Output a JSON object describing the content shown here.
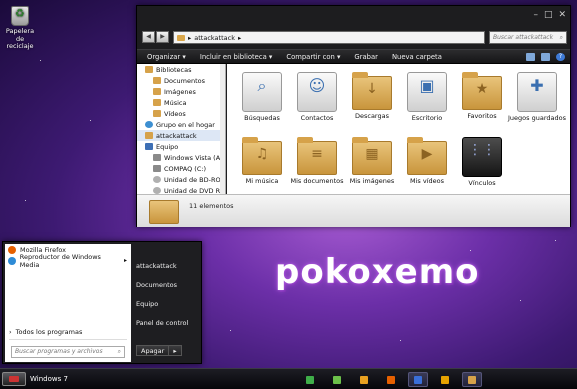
{
  "desktop": {
    "recycle_bin_label": "Papelera de reciclaje"
  },
  "explorer": {
    "address": "attackattack",
    "search_placeholder": "Buscar attackattack",
    "toolbar": {
      "organize": "Organizar ▾",
      "include": "Incluir en biblioteca ▾",
      "share": "Compartir con ▾",
      "burn": "Grabar",
      "new_folder": "Nueva carpeta"
    },
    "nav_items": [
      {
        "label": "Bibliotecas",
        "icon": "library-icon",
        "indent": 0
      },
      {
        "label": "Documentos",
        "icon": "folder-icon",
        "indent": 1
      },
      {
        "label": "Imágenes",
        "icon": "folder-icon",
        "indent": 1
      },
      {
        "label": "Música",
        "icon": "folder-icon",
        "indent": 1
      },
      {
        "label": "Vídeos",
        "icon": "folder-icon",
        "indent": 1
      },
      {
        "label": "Grupo en el hogar",
        "icon": "homegroup-icon",
        "indent": 0
      },
      {
        "label": "attackattack",
        "icon": "user-folder-icon",
        "indent": 0,
        "selected": true
      },
      {
        "label": "Equipo",
        "icon": "computer-icon",
        "indent": 0
      },
      {
        "label": "Windows Vista (A:)",
        "icon": "drive-icon",
        "indent": 1
      },
      {
        "label": "COMPAQ (C:)",
        "icon": "drive-icon",
        "indent": 1
      },
      {
        "label": "Unidad de BD-ROM (",
        "icon": "disc-icon",
        "indent": 1
      },
      {
        "label": "Unidad de DVD RW (",
        "icon": "disc-icon",
        "indent": 1
      }
    ],
    "tiles": [
      {
        "label": "Búsquedas",
        "icon": "search-folder-icon"
      },
      {
        "label": "Contactos",
        "icon": "contacts-icon"
      },
      {
        "label": "Descargas",
        "icon": "downloads-folder-icon"
      },
      {
        "label": "Escritorio",
        "icon": "desktop-folder-icon"
      },
      {
        "label": "Favoritos",
        "icon": "favorites-folder-icon"
      },
      {
        "label": "Juegos guardados",
        "icon": "saved-games-icon"
      },
      {
        "label": "Mi música",
        "icon": "music-folder-icon"
      },
      {
        "label": "Mis documentos",
        "icon": "documents-folder-icon"
      },
      {
        "label": "Mis imágenes",
        "icon": "pictures-folder-icon"
      },
      {
        "label": "Mis vídeos",
        "icon": "videos-folder-icon"
      },
      {
        "label": "Vínculos",
        "icon": "links-icon"
      }
    ],
    "status_count": "11 elementos"
  },
  "start_menu": {
    "programs": [
      {
        "label": "Mozilla Firefox",
        "icon": "firefox-icon",
        "color": "#e66000",
        "has_arrow": false
      },
      {
        "label": "Reproductor de Windows Media",
        "icon": "media-player-icon",
        "color": "#2e8bd6",
        "has_arrow": true
      }
    ],
    "all_programs": "Todos los programas",
    "search_placeholder": "Buscar programas y archivos",
    "right_items": [
      "attackattack",
      "Documentos",
      "Equipo",
      "Panel de control"
    ],
    "shutdown_label": "Apagar"
  },
  "watermark": "pokoxemo",
  "taskbar": {
    "label": "Windows 7",
    "icons": [
      {
        "name": "taskbar-app-1-icon",
        "color": "#3fae49"
      },
      {
        "name": "taskbar-app-2-icon",
        "color": "#6cc04a"
      },
      {
        "name": "taskbar-app-3-icon",
        "color": "#e8a020"
      },
      {
        "name": "taskbar-firefox-icon",
        "color": "#e66000"
      },
      {
        "name": "taskbar-app-5-icon",
        "color": "#3a6fd8",
        "active": true
      },
      {
        "name": "taskbar-media-icon",
        "color": "#e6a200"
      },
      {
        "name": "taskbar-explorer-icon",
        "color": "#d6a24a",
        "active": true
      }
    ]
  }
}
